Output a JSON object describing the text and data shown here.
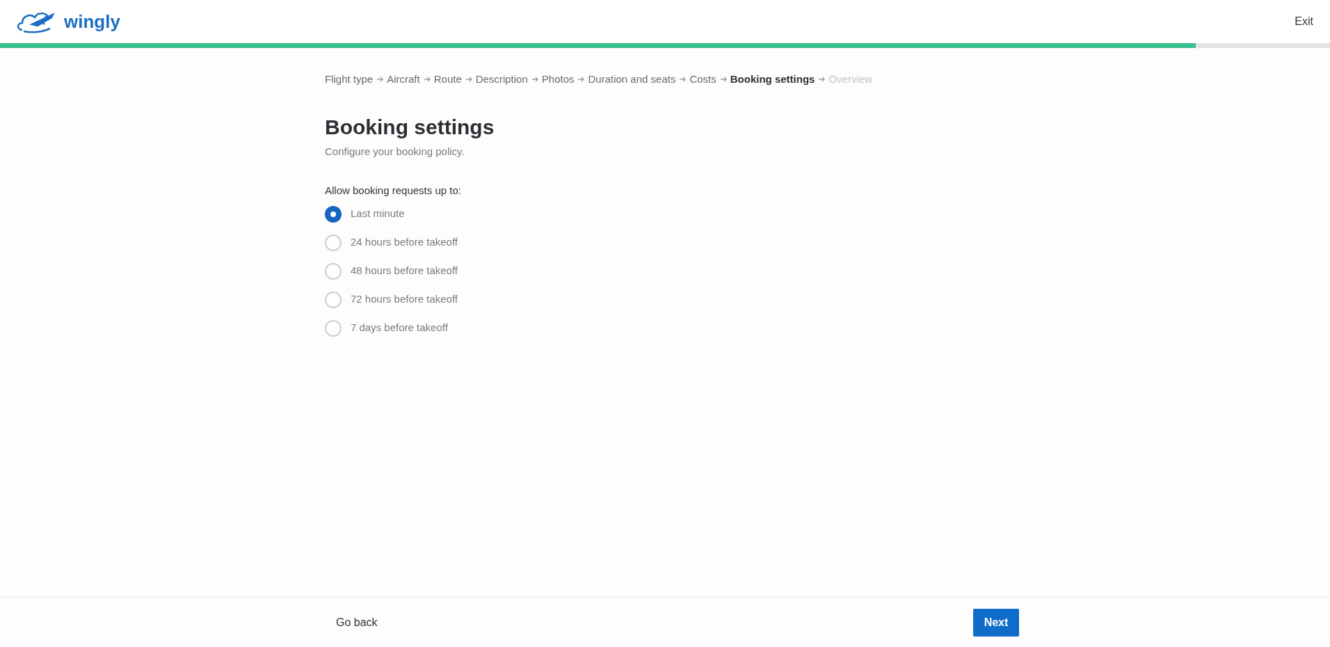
{
  "header": {
    "logo_text": "wingly",
    "exit": "Exit"
  },
  "progress": {
    "level": 0.899
  },
  "breadcrumb": [
    {
      "label": "Flight type",
      "selected": false,
      "disabled": false
    },
    {
      "label": "Aircraft",
      "selected": false,
      "disabled": false
    },
    {
      "label": "Route",
      "selected": false,
      "disabled": false
    },
    {
      "label": "Description",
      "selected": false,
      "disabled": false
    },
    {
      "label": "Photos",
      "selected": false,
      "disabled": false
    },
    {
      "label": "Duration and seats",
      "selected": false,
      "disabled": false
    },
    {
      "label": "Costs",
      "selected": false,
      "disabled": false
    },
    {
      "label": "Booking settings",
      "selected": true,
      "disabled": false
    },
    {
      "label": "Overview",
      "selected": false,
      "disabled": true
    }
  ],
  "title": "Booking settings",
  "subtitle": "Configure your booking policy.",
  "question": "Allow booking requests up to:",
  "options": [
    {
      "label": "Last minute",
      "selected": true
    },
    {
      "label": "24 hours before takeoff",
      "selected": false
    },
    {
      "label": "48 hours before takeoff",
      "selected": false
    },
    {
      "label": "72 hours before takeoff",
      "selected": false
    },
    {
      "label": "7 days before takeoff",
      "selected": false
    }
  ],
  "footer": {
    "back": "Go back",
    "next": "Next"
  }
}
